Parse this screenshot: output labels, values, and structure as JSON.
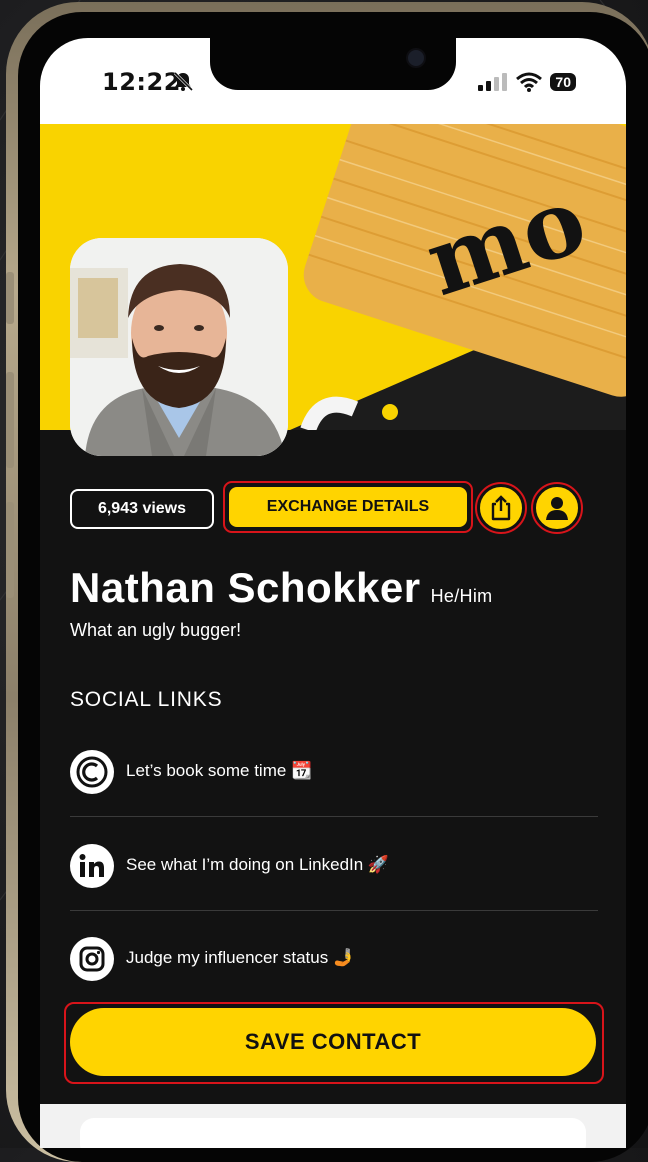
{
  "status_bar": {
    "time": "12:22",
    "battery": "70"
  },
  "profile": {
    "views": "6,943 views",
    "exchange_label": "EXCHANGE DETAILS",
    "name": "Nathan Schokker",
    "pronouns": "He/Him",
    "bio": "What an ugly bugger!"
  },
  "banner": {
    "card_text": "mo"
  },
  "social": {
    "title": "SOCIAL LINKS",
    "links": [
      {
        "icon": "calendly-icon",
        "label": "Let’s book some time 📆"
      },
      {
        "icon": "linkedin-icon",
        "label": "See what I’m doing on LinkedIn 🚀"
      },
      {
        "icon": "instagram-icon",
        "label": "Judge my influencer status 🤳"
      }
    ]
  },
  "save_label": "SAVE CONTACT",
  "colors": {
    "accent": "#ffd400",
    "background": "#121212",
    "highlight": "#d8141a"
  }
}
